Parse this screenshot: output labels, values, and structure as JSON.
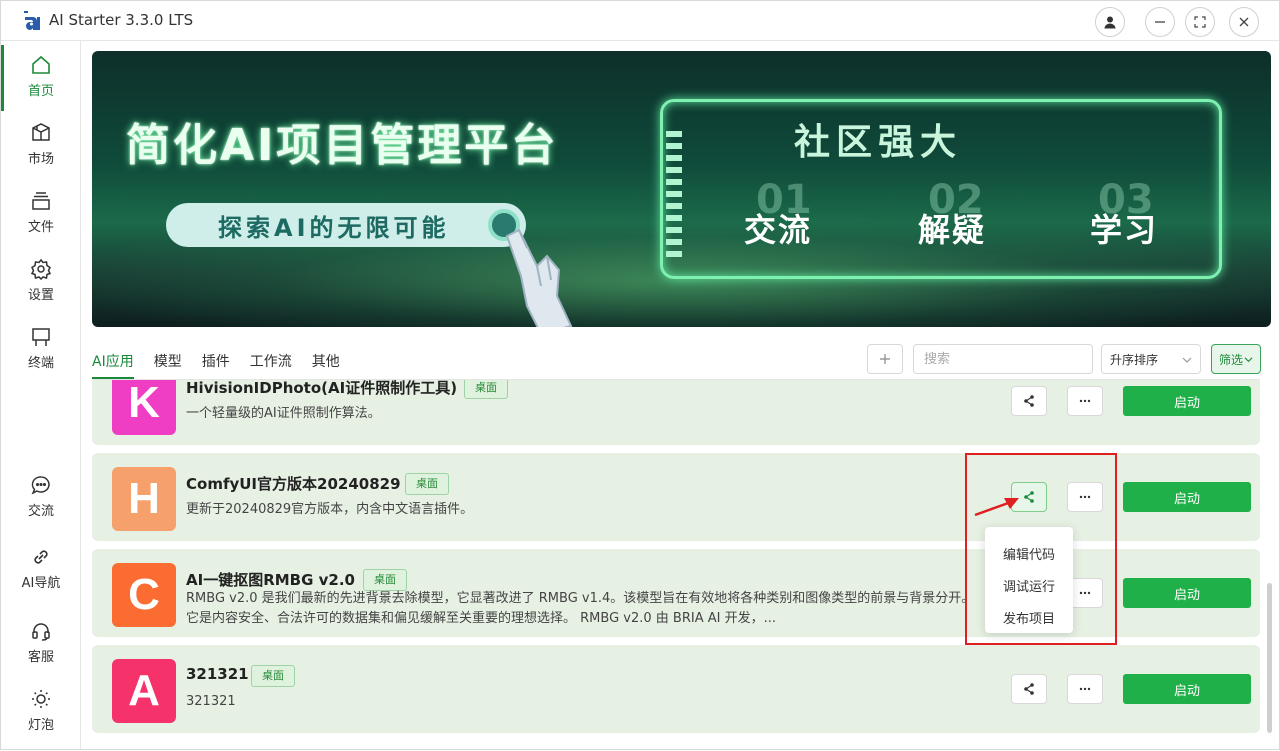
{
  "app": {
    "title": "AI Starter 3.3.0 LTS",
    "accent": "#1a8a3a"
  },
  "titlebar": {
    "buttons": [
      "user-icon",
      "minimize-icon",
      "maximize-icon",
      "close-icon"
    ]
  },
  "sidebar": {
    "items": [
      {
        "label": "首页",
        "icon": "home-icon",
        "active": true
      },
      {
        "label": "市场",
        "icon": "store-icon"
      },
      {
        "label": "文件",
        "icon": "files-icon"
      },
      {
        "label": "设置",
        "icon": "settings-icon"
      },
      {
        "label": "终端",
        "icon": "terminal-icon"
      }
    ],
    "bottom_items": [
      {
        "label": "交流",
        "icon": "chat-icon"
      },
      {
        "label": "AI导航",
        "icon": "link-icon"
      },
      {
        "label": "客服",
        "icon": "headset-icon"
      },
      {
        "label": "灯泡",
        "icon": "bulb-icon"
      }
    ]
  },
  "banner": {
    "title": "简化AI项目管理平台",
    "pill": "探索AI的无限可能",
    "frame_title": "社区强大",
    "steps": [
      {
        "num": "01",
        "word": "交流"
      },
      {
        "num": "02",
        "word": "解疑"
      },
      {
        "num": "03",
        "word": "学习"
      }
    ],
    "carousel_active": 3,
    "carousel_total": 3
  },
  "tabs": {
    "items": [
      "AI应用",
      "模型",
      "插件",
      "工作流",
      "其他"
    ],
    "active": 0
  },
  "toolbar": {
    "add_label": "+",
    "search_placeholder": "搜索",
    "sort_label": "升序排序",
    "filter_label": "筛选"
  },
  "apps": [
    {
      "letter": "K",
      "color": "#f03ec4",
      "name": "HivisionIDPhoto(AI证件照制作工具)",
      "badge": "桌面",
      "desc": "一个轻量级的AI证件照制作算法。",
      "start": "启动"
    },
    {
      "letter": "H",
      "color": "#f6a06c",
      "name": "ComfyUI官方版本20240829",
      "badge": "桌面",
      "desc": "更新于20240829官方版本，内含中文语言插件。",
      "start": "启动"
    },
    {
      "letter": "C",
      "color": "#fb6c32",
      "name": "AI一键抠图RMBG v2.0",
      "badge": "桌面",
      "desc": "RMBG v2.0 是我们最新的先进背景去除模型，它显著改进了 RMBG v1.4。该模型旨在有效地将各种类别和图像类型的前景与背景分开。它是内容安全、合法许可的数据集和偏见缓解至关重要的理想选择。 RMBG v2.0 由 BRIA AI 开发，...",
      "start": "启动"
    },
    {
      "letter": "A",
      "color": "#f5336a",
      "name": "321321",
      "badge": "桌面",
      "desc": "321321",
      "start": "启动"
    }
  ],
  "share_menu": {
    "items": [
      "编辑代码",
      "调试运行",
      "发布项目"
    ]
  }
}
